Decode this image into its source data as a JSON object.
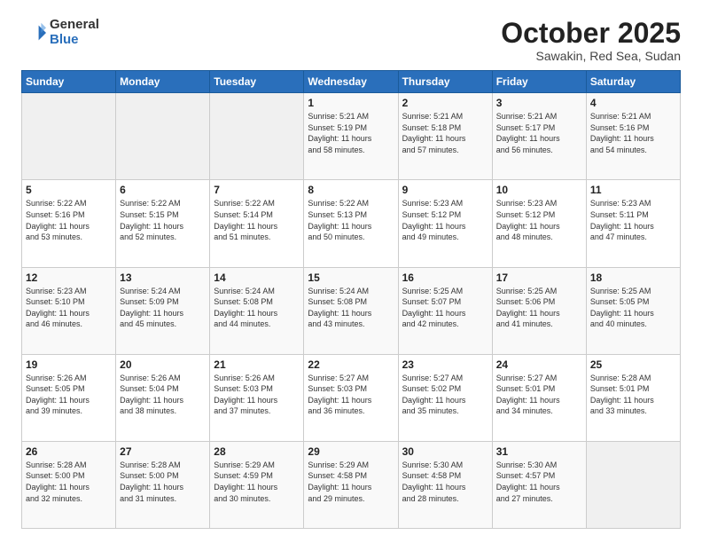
{
  "logo": {
    "general": "General",
    "blue": "Blue"
  },
  "title": "October 2025",
  "subtitle": "Sawakin, Red Sea, Sudan",
  "days_of_week": [
    "Sunday",
    "Monday",
    "Tuesday",
    "Wednesday",
    "Thursday",
    "Friday",
    "Saturday"
  ],
  "weeks": [
    [
      {
        "day": "",
        "info": ""
      },
      {
        "day": "",
        "info": ""
      },
      {
        "day": "",
        "info": ""
      },
      {
        "day": "1",
        "info": "Sunrise: 5:21 AM\nSunset: 5:19 PM\nDaylight: 11 hours\nand 58 minutes."
      },
      {
        "day": "2",
        "info": "Sunrise: 5:21 AM\nSunset: 5:18 PM\nDaylight: 11 hours\nand 57 minutes."
      },
      {
        "day": "3",
        "info": "Sunrise: 5:21 AM\nSunset: 5:17 PM\nDaylight: 11 hours\nand 56 minutes."
      },
      {
        "day": "4",
        "info": "Sunrise: 5:21 AM\nSunset: 5:16 PM\nDaylight: 11 hours\nand 54 minutes."
      }
    ],
    [
      {
        "day": "5",
        "info": "Sunrise: 5:22 AM\nSunset: 5:16 PM\nDaylight: 11 hours\nand 53 minutes."
      },
      {
        "day": "6",
        "info": "Sunrise: 5:22 AM\nSunset: 5:15 PM\nDaylight: 11 hours\nand 52 minutes."
      },
      {
        "day": "7",
        "info": "Sunrise: 5:22 AM\nSunset: 5:14 PM\nDaylight: 11 hours\nand 51 minutes."
      },
      {
        "day": "8",
        "info": "Sunrise: 5:22 AM\nSunset: 5:13 PM\nDaylight: 11 hours\nand 50 minutes."
      },
      {
        "day": "9",
        "info": "Sunrise: 5:23 AM\nSunset: 5:12 PM\nDaylight: 11 hours\nand 49 minutes."
      },
      {
        "day": "10",
        "info": "Sunrise: 5:23 AM\nSunset: 5:12 PM\nDaylight: 11 hours\nand 48 minutes."
      },
      {
        "day": "11",
        "info": "Sunrise: 5:23 AM\nSunset: 5:11 PM\nDaylight: 11 hours\nand 47 minutes."
      }
    ],
    [
      {
        "day": "12",
        "info": "Sunrise: 5:23 AM\nSunset: 5:10 PM\nDaylight: 11 hours\nand 46 minutes."
      },
      {
        "day": "13",
        "info": "Sunrise: 5:24 AM\nSunset: 5:09 PM\nDaylight: 11 hours\nand 45 minutes."
      },
      {
        "day": "14",
        "info": "Sunrise: 5:24 AM\nSunset: 5:08 PM\nDaylight: 11 hours\nand 44 minutes."
      },
      {
        "day": "15",
        "info": "Sunrise: 5:24 AM\nSunset: 5:08 PM\nDaylight: 11 hours\nand 43 minutes."
      },
      {
        "day": "16",
        "info": "Sunrise: 5:25 AM\nSunset: 5:07 PM\nDaylight: 11 hours\nand 42 minutes."
      },
      {
        "day": "17",
        "info": "Sunrise: 5:25 AM\nSunset: 5:06 PM\nDaylight: 11 hours\nand 41 minutes."
      },
      {
        "day": "18",
        "info": "Sunrise: 5:25 AM\nSunset: 5:05 PM\nDaylight: 11 hours\nand 40 minutes."
      }
    ],
    [
      {
        "day": "19",
        "info": "Sunrise: 5:26 AM\nSunset: 5:05 PM\nDaylight: 11 hours\nand 39 minutes."
      },
      {
        "day": "20",
        "info": "Sunrise: 5:26 AM\nSunset: 5:04 PM\nDaylight: 11 hours\nand 38 minutes."
      },
      {
        "day": "21",
        "info": "Sunrise: 5:26 AM\nSunset: 5:03 PM\nDaylight: 11 hours\nand 37 minutes."
      },
      {
        "day": "22",
        "info": "Sunrise: 5:27 AM\nSunset: 5:03 PM\nDaylight: 11 hours\nand 36 minutes."
      },
      {
        "day": "23",
        "info": "Sunrise: 5:27 AM\nSunset: 5:02 PM\nDaylight: 11 hours\nand 35 minutes."
      },
      {
        "day": "24",
        "info": "Sunrise: 5:27 AM\nSunset: 5:01 PM\nDaylight: 11 hours\nand 34 minutes."
      },
      {
        "day": "25",
        "info": "Sunrise: 5:28 AM\nSunset: 5:01 PM\nDaylight: 11 hours\nand 33 minutes."
      }
    ],
    [
      {
        "day": "26",
        "info": "Sunrise: 5:28 AM\nSunset: 5:00 PM\nDaylight: 11 hours\nand 32 minutes."
      },
      {
        "day": "27",
        "info": "Sunrise: 5:28 AM\nSunset: 5:00 PM\nDaylight: 11 hours\nand 31 minutes."
      },
      {
        "day": "28",
        "info": "Sunrise: 5:29 AM\nSunset: 4:59 PM\nDaylight: 11 hours\nand 30 minutes."
      },
      {
        "day": "29",
        "info": "Sunrise: 5:29 AM\nSunset: 4:58 PM\nDaylight: 11 hours\nand 29 minutes."
      },
      {
        "day": "30",
        "info": "Sunrise: 5:30 AM\nSunset: 4:58 PM\nDaylight: 11 hours\nand 28 minutes."
      },
      {
        "day": "31",
        "info": "Sunrise: 5:30 AM\nSunset: 4:57 PM\nDaylight: 11 hours\nand 27 minutes."
      },
      {
        "day": "",
        "info": ""
      }
    ]
  ]
}
